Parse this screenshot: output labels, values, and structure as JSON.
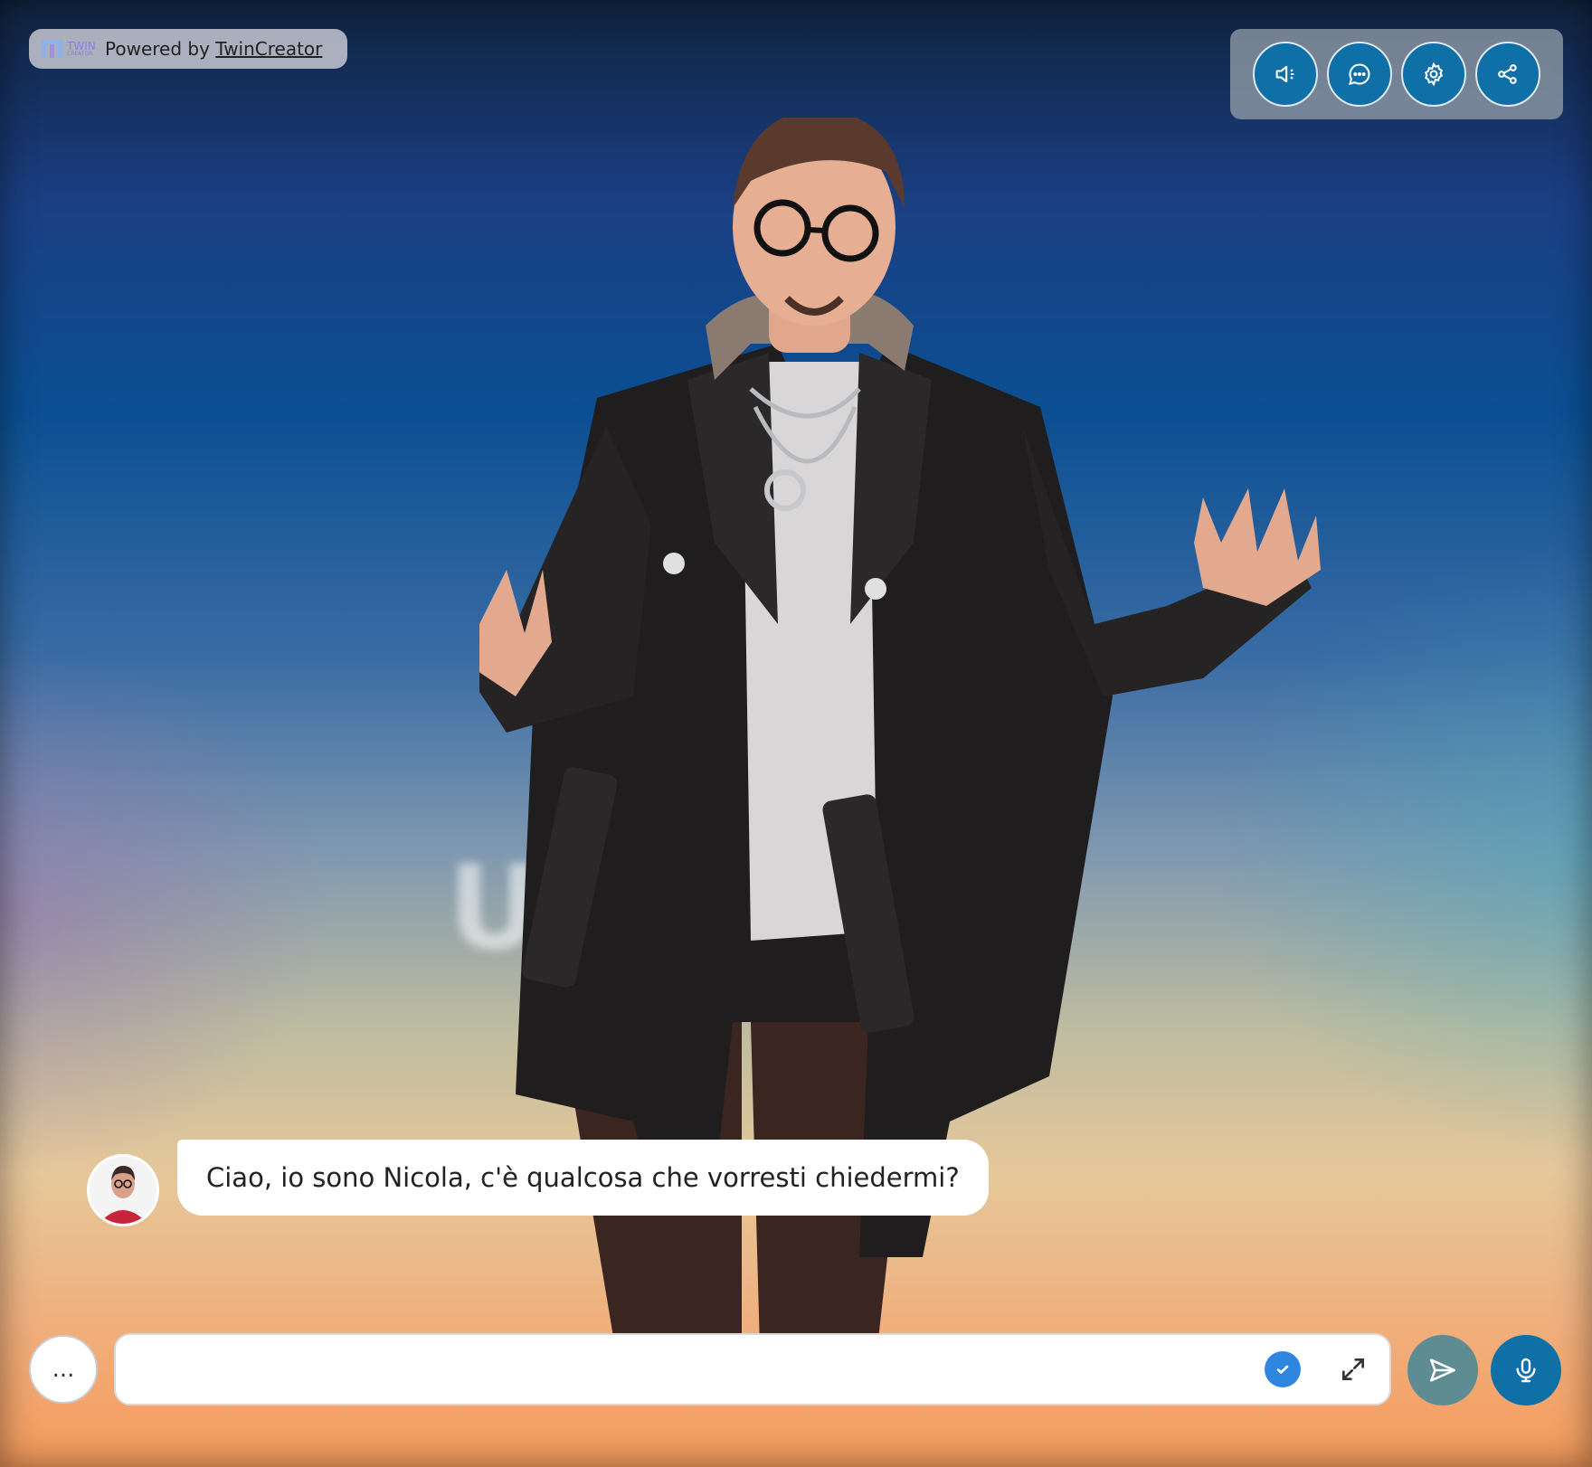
{
  "branding": {
    "powered_prefix": "Powered by",
    "powered_link": "TwinCreator",
    "logo_text_line1": "TWIN",
    "logo_text_line2": "CREATOR"
  },
  "toolbar": {
    "buttons": [
      {
        "icon": "speaker-icon"
      },
      {
        "icon": "chat-bubble-icon"
      },
      {
        "icon": "gear-icon"
      },
      {
        "icon": "share-icon"
      }
    ],
    "accent": "#0f70a8"
  },
  "background": {
    "blurred_word": "UNI  E"
  },
  "chat": {
    "messages": [
      {
        "from": "bot",
        "name": "Nicola",
        "text": "Ciao, io sono Nicola, c'è qualcosa che vorresti chiedermi?"
      }
    ]
  },
  "composer": {
    "more_label": "...",
    "input_value": "",
    "input_placeholder": ""
  }
}
